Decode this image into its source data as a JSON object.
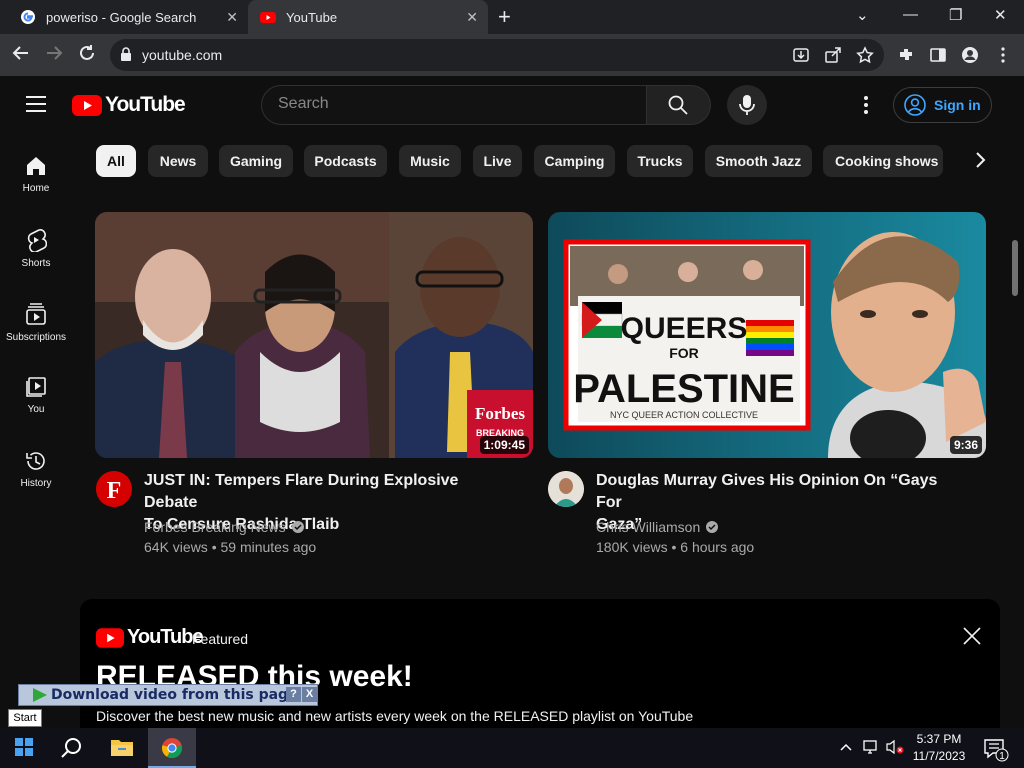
{
  "browser": {
    "tabs": [
      {
        "title": "poweriso - Google Search",
        "active": false
      },
      {
        "title": "YouTube",
        "active": true
      }
    ],
    "url": "youtube.com"
  },
  "header": {
    "logo_text": "YouTube",
    "search_placeholder": "Search",
    "signin_label": "Sign in"
  },
  "sidebar": {
    "items": [
      {
        "label": "Home",
        "icon": "home-icon"
      },
      {
        "label": "Shorts",
        "icon": "shorts-icon"
      },
      {
        "label": "Subscriptions",
        "icon": "subscriptions-icon"
      },
      {
        "label": "You",
        "icon": "you-icon"
      },
      {
        "label": "History",
        "icon": "history-icon"
      }
    ]
  },
  "chips": [
    "All",
    "News",
    "Gaming",
    "Podcasts",
    "Music",
    "Live",
    "Camping",
    "Trucks",
    "Smooth Jazz",
    "Cooking shows"
  ],
  "videos": [
    {
      "title_line1": "JUST IN: Tempers Flare During Explosive Debate",
      "title_line2": "To Censure Rashida Tlaib",
      "channel": "Forbes Breaking News",
      "meta": "64K views • 59 minutes ago",
      "duration": "1:09:45",
      "thumb_brand": "Forbes",
      "thumb_tag": "BREAKING"
    },
    {
      "title_line1": "Douglas Murray Gives His Opinion On “Gays For",
      "title_line2": "Gaza”",
      "channel": "Chris Williamson",
      "meta": "180K views • 6 hours ago",
      "duration": "9:36",
      "banner_line1": "QUEERS",
      "banner_line2": "FOR",
      "banner_line3": "PALESTINE",
      "banner_line4": "NYC QUEER ACTION COLLECTIVE"
    }
  ],
  "featured": {
    "logo_text": "YouTube",
    "label": "Featured",
    "title": "RELEASED this week!",
    "description": "Discover the best new music and new artists every week on the RELEASED playlist on YouTube"
  },
  "overlay": {
    "download_text": "Download video from this page",
    "help": "?",
    "close": "X",
    "start_tip": "Start"
  },
  "taskbar": {
    "time": "5:37 PM",
    "date": "11/7/2023",
    "notification_count": "1"
  },
  "colors": {
    "yt_red": "#ff0000",
    "link_blue": "#3ea6ff",
    "background": "#0f0f0f"
  }
}
